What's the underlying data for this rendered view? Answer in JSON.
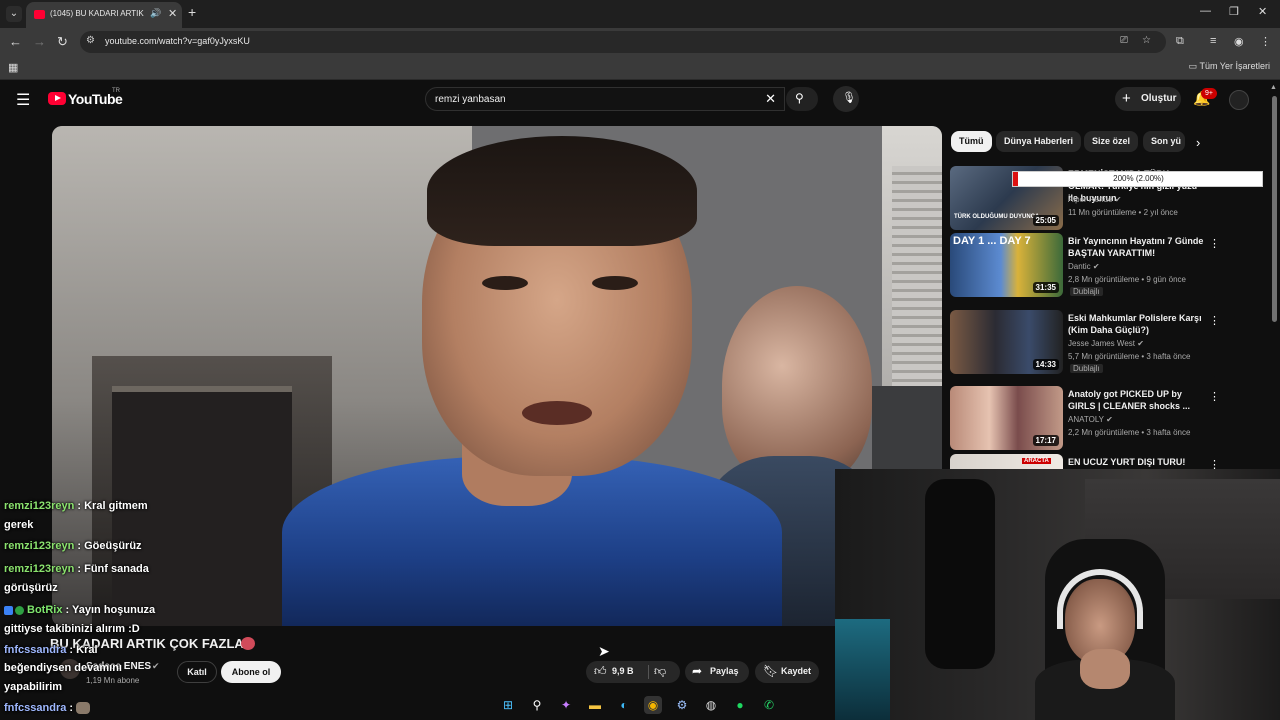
{
  "browser": {
    "tab_title": "(1045) BU KADARI ARTIK ÇOK FAZLA!",
    "url": "youtube.com/watch?v=gaf0yJyxsKU",
    "bookmarks_label": "Tüm Yer İşaretleri"
  },
  "header": {
    "logo_text": "YouTube",
    "country_code": "TR",
    "search_value": "remzi yanbasan",
    "create_label": "Oluştur",
    "notif_count": "9+"
  },
  "chips": [
    "Tümü",
    "Dünya Haberleri",
    "Size özel",
    "Son yü"
  ],
  "video": {
    "title": "BU KADARI ARTIK ÇOK FAZLA!",
    "channel": "Sadece ENES",
    "subscribers": "1,19 Mn abone",
    "join_label": "Katıl",
    "subscribe_label": "Abone ol",
    "likes": "9,9 B",
    "share_label": "Paylaş",
    "save_label": "Kaydet"
  },
  "progress_tooltip": {
    "text": "200% (2.00%)",
    "fraction": 0.02
  },
  "recommendations": [
    {
      "title": "ERMENİSTAN'DA TÜRK OLMAK! Türkiye'nin gizli yüzü ile buyurun",
      "channel": "Alper Rende",
      "meta": "11 Mn görüntüleme • 2 yıl önce",
      "duration": "25:05",
      "thumb_label": "TÜRK OLDUĞUMU DUYUNCA",
      "badge": ""
    },
    {
      "title": "Bir Yayıncının Hayatını 7 Günde BAŞTAN YARATTIM!",
      "channel": "Dantic",
      "meta": "2,8 Mn görüntüleme • 9 gün önce",
      "duration": "31:35",
      "thumb_label": "DAY 1 ... DAY 7",
      "badge": "Dublajlı"
    },
    {
      "title": "Eski Mahkumlar Polislere Karşı (Kim Daha Güçlü?)",
      "channel": "Jesse James West",
      "meta": "5,7 Mn görüntüleme • 3 hafta önce",
      "duration": "14:33",
      "thumb_label": "",
      "badge": "Dublajlı"
    },
    {
      "title": "Anatoly got PICKED UP by GIRLS | CLEANER shocks ...",
      "channel": "ANATOLY",
      "meta": "2,2 Mn görüntüleme • 3 hafta önce",
      "duration": "17:17",
      "thumb_label": "",
      "badge": ""
    },
    {
      "title": "EN UCUZ YURT DIŞI TURU!",
      "channel": "",
      "meta": "",
      "duration": "",
      "thumb_label": "ARACTA",
      "badge": ""
    }
  ],
  "chat": [
    {
      "user": "remzi123reyn",
      "msg": ": Kral gitmem",
      "cont": "gerek"
    },
    {
      "user": "remzi123reyn",
      "msg": ": Göeüşürüz",
      "cont": ""
    },
    {
      "user": "remzi123reyn",
      "msg": ": Fünf sanada",
      "cont": "görüşürüz"
    },
    {
      "user": "BotRix",
      "msg": ": Yayın hoşunuza",
      "cont": "gittiyse takibinizi alırım :D"
    },
    {
      "user": "fnfcssandra",
      "msg": ": Kral",
      "cont": "beğendiysen devamını"
    },
    {
      "user": "",
      "msg": "yapabilirim",
      "cont": ""
    },
    {
      "user": "fnfcssandra",
      "msg": ":",
      "cont": ""
    }
  ],
  "icons": {
    "colors": {
      "brand_red": "#ff0033",
      "chip_active_bg": "#f1f1f1",
      "chat_user_green": "#8be36e"
    }
  }
}
